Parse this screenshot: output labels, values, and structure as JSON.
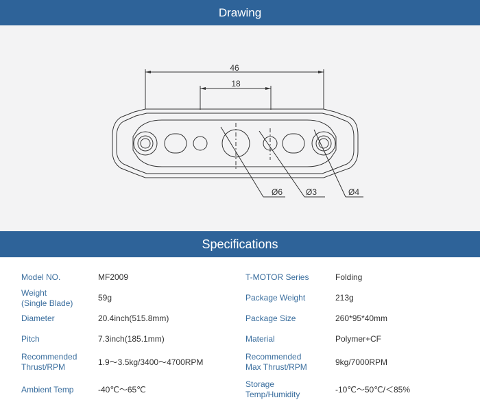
{
  "drawing": {
    "title": "Drawing",
    "dimensions": {
      "overall": "46",
      "inner": "18",
      "hole_large": "Ø6",
      "hole_medium": "Ø3",
      "hole_small": "Ø4"
    }
  },
  "specifications": {
    "title": "Specifications",
    "rows": [
      {
        "label_left": "Model NO.",
        "value_left": "MF2009",
        "label_right": "T-MOTOR Series",
        "value_right": "Folding"
      },
      {
        "label_left": "Weight\n(Single Blade)",
        "value_left": "59g",
        "label_right": "Package Weight",
        "value_right": "213g"
      },
      {
        "label_left": "Diameter",
        "value_left": "20.4inch(515.8mm)",
        "label_right": "Package Size",
        "value_right": "260*95*40mm"
      },
      {
        "label_left": "Pitch",
        "value_left": "7.3inch(185.1mm)",
        "label_right": "Material",
        "value_right": "Polymer+CF"
      },
      {
        "label_left": "Recommended\nThrust/RPM",
        "value_left": "1.9～3.5kg/3400～4700RPM",
        "label_right": "Recommended\nMax Thrust/RPM",
        "value_right": "9kg/7000RPM"
      },
      {
        "label_left": "Ambient Temp",
        "value_left": "-40℃～65℃",
        "label_right": "Storage\nTemp/Humidity",
        "value_right": "-10℃～50℃/＜85%"
      }
    ]
  }
}
